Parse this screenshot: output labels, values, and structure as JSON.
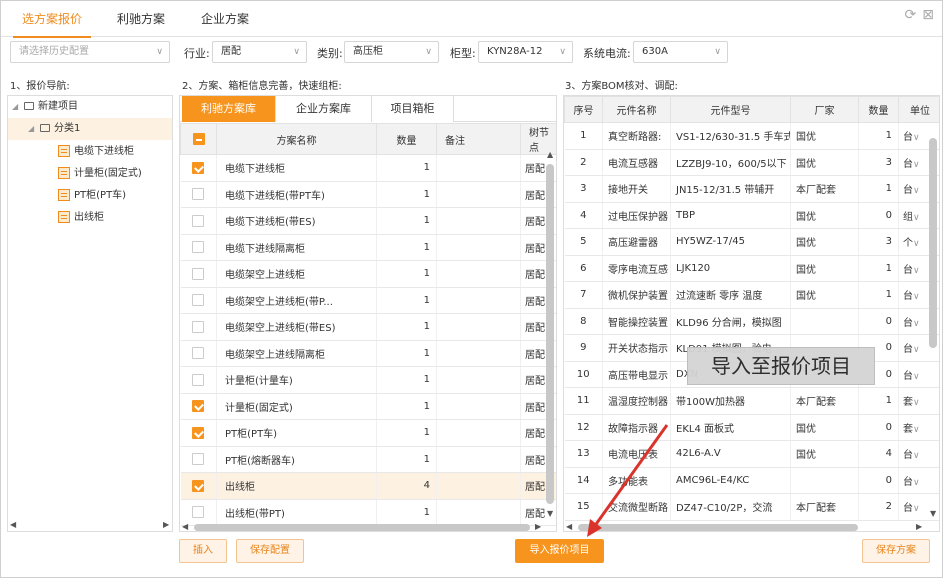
{
  "tabs": [
    {
      "label": "选方案报价"
    },
    {
      "label": "利驰方案"
    },
    {
      "label": "企业方案"
    }
  ],
  "toolbar": {
    "history_placeholder": "请选择历史配置",
    "industry_label": "行业:",
    "industry_value": "居配",
    "category_label": "类别:",
    "category_value": "高压柜",
    "cabinet_label": "柜型:",
    "cabinet_value": "KYN28A-12",
    "current_label": "系统电流:",
    "current_value": "630A"
  },
  "sections": {
    "nav_title": "1、报价导航:",
    "scheme_title": "2、方案、箱柜信息完善，快速组柜:",
    "bom_title": "3、方案BOM核对、调配:"
  },
  "tree": {
    "root": "新建项目",
    "group": "分类1",
    "items": [
      "电缆下进线柜",
      "计量柜(固定式)",
      "PT柜(PT车)",
      "出线柜"
    ]
  },
  "scheme_tabs": [
    "利驰方案库",
    "企业方案库",
    "项目箱柜"
  ],
  "scheme_table": {
    "headers": [
      "方案名称",
      "数量",
      "备注",
      "树节点"
    ],
    "rows": [
      {
        "name": "电缆下进线柜",
        "qty": "1",
        "checked": true,
        "node": "居配"
      },
      {
        "name": "电缆下进线柜(带PT车)",
        "qty": "1",
        "checked": false,
        "node": "居配"
      },
      {
        "name": "电缆下进线柜(带ES)",
        "qty": "1",
        "checked": false,
        "node": "居配"
      },
      {
        "name": "电缆下进线隔离柜",
        "qty": "1",
        "checked": false,
        "node": "居配"
      },
      {
        "name": "电缆架空上进线柜",
        "qty": "1",
        "checked": false,
        "node": "居配"
      },
      {
        "name": "电缆架空上进线柜(带P...",
        "qty": "1",
        "checked": false,
        "node": "居配"
      },
      {
        "name": "电缆架空上进线柜(带ES)",
        "qty": "1",
        "checked": false,
        "node": "居配"
      },
      {
        "name": "电缆架空上进线隔离柜",
        "qty": "1",
        "checked": false,
        "node": "居配"
      },
      {
        "name": "计量柜(计量车)",
        "qty": "1",
        "checked": false,
        "node": "居配"
      },
      {
        "name": "计量柜(固定式)",
        "qty": "1",
        "checked": true,
        "node": "居配"
      },
      {
        "name": "PT柜(PT车)",
        "qty": "1",
        "checked": true,
        "node": "居配"
      },
      {
        "name": "PT柜(熔断器车)",
        "qty": "1",
        "checked": false,
        "node": "居配"
      },
      {
        "name": "出线柜",
        "qty": "4",
        "checked": true,
        "node": "居配"
      },
      {
        "name": "出线柜(带PT)",
        "qty": "1",
        "checked": false,
        "node": "居配"
      }
    ]
  },
  "bom_table": {
    "headers": [
      "序号",
      "元件名称",
      "元件型号",
      "厂家",
      "数量",
      "单位"
    ],
    "rows": [
      {
        "no": "1",
        "name": "真空断路器:",
        "model": "VS1-12/630-31.5 手车式",
        "maker": "国优",
        "qty": "1",
        "unit": "台"
      },
      {
        "no": "2",
        "name": "电流互感器",
        "model": "LZZBJ9-10，600/5以下",
        "maker": "国优",
        "qty": "3",
        "unit": "台"
      },
      {
        "no": "3",
        "name": "接地开关",
        "model": "JN15-12/31.5 带辅开",
        "maker": "本厂配套",
        "qty": "1",
        "unit": "台"
      },
      {
        "no": "4",
        "name": "过电压保护器",
        "model": "TBP",
        "maker": "国优",
        "qty": "0",
        "unit": "组"
      },
      {
        "no": "5",
        "name": "高压避雷器",
        "model": "HY5WZ-17/45",
        "maker": "国优",
        "qty": "3",
        "unit": "个"
      },
      {
        "no": "6",
        "name": "零序电流互感",
        "model": "LJK120",
        "maker": "国优",
        "qty": "1",
        "unit": "台"
      },
      {
        "no": "7",
        "name": "微机保护装置",
        "model": "过流速断 零序 温度",
        "maker": "国优",
        "qty": "1",
        "unit": "台"
      },
      {
        "no": "8",
        "name": "智能操控装置",
        "model": "KLD96 分合闸，模拟图",
        "maker": "",
        "qty": "0",
        "unit": "台"
      },
      {
        "no": "9",
        "name": "开关状态指示",
        "model": "KLD91 模拟图，验电",
        "maker": "",
        "qty": "0",
        "unit": "台"
      },
      {
        "no": "10",
        "name": "高压带电显示",
        "model": "DXN",
        "maker": "",
        "qty": "0",
        "unit": "台"
      },
      {
        "no": "11",
        "name": "温湿度控制器",
        "model": "带100W加热器",
        "maker": "本厂配套",
        "qty": "1",
        "unit": "套"
      },
      {
        "no": "12",
        "name": "故障指示器",
        "model": "EKL4 面板式",
        "maker": "国优",
        "qty": "0",
        "unit": "套"
      },
      {
        "no": "13",
        "name": "电流电压表",
        "model": "42L6-A.V",
        "maker": "国优",
        "qty": "4",
        "unit": "台"
      },
      {
        "no": "14",
        "name": "多功能表",
        "model": "AMC96L-E4/KC",
        "maker": "",
        "qty": "0",
        "unit": "台"
      },
      {
        "no": "15",
        "name": "交流微型断路",
        "model": "DZ47-C10/2P，交流",
        "maker": "本厂配套",
        "qty": "2",
        "unit": "台"
      }
    ]
  },
  "buttons": {
    "insert": "插入",
    "save_config": "保存配置",
    "import": "导入报价项目",
    "save_scheme": "保存方案"
  },
  "tooltip": "导入至报价项目",
  "colors": {
    "accent": "#f7941d",
    "highlight": "#fdf1e2"
  }
}
